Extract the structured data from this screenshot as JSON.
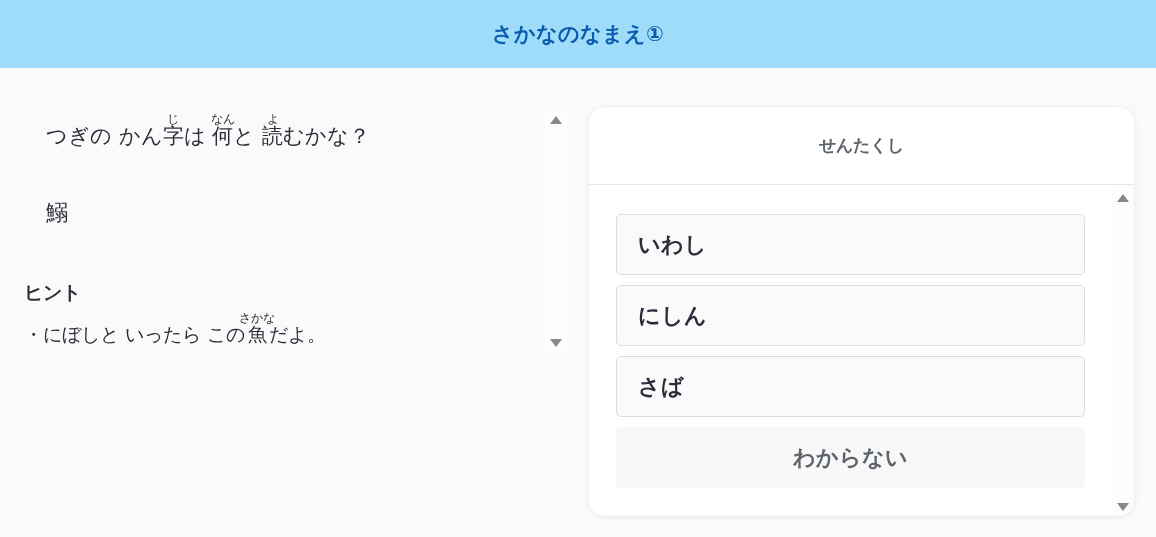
{
  "header": {
    "title": "さかなのなまえ①"
  },
  "question": {
    "segments": [
      {
        "text": "つぎの かん"
      },
      {
        "text": "字",
        "ruby": "じ"
      },
      {
        "text": "は "
      },
      {
        "text": "何",
        "ruby": "なん"
      },
      {
        "text": "と "
      },
      {
        "text": "読",
        "ruby": "よ"
      },
      {
        "text": "むかな？"
      }
    ]
  },
  "kanji": "鰯",
  "hint": {
    "title": "ヒント",
    "segments": [
      {
        "text": "・にぼしと いったら この"
      },
      {
        "text": "魚",
        "ruby": "さかな"
      },
      {
        "text": "だよ。"
      }
    ]
  },
  "choices": {
    "title": "せんたくし",
    "items": [
      {
        "label": "いわし",
        "kind": "option"
      },
      {
        "label": "にしん",
        "kind": "option"
      },
      {
        "label": "さば",
        "kind": "option"
      },
      {
        "label": "わからない",
        "kind": "skip"
      }
    ]
  }
}
